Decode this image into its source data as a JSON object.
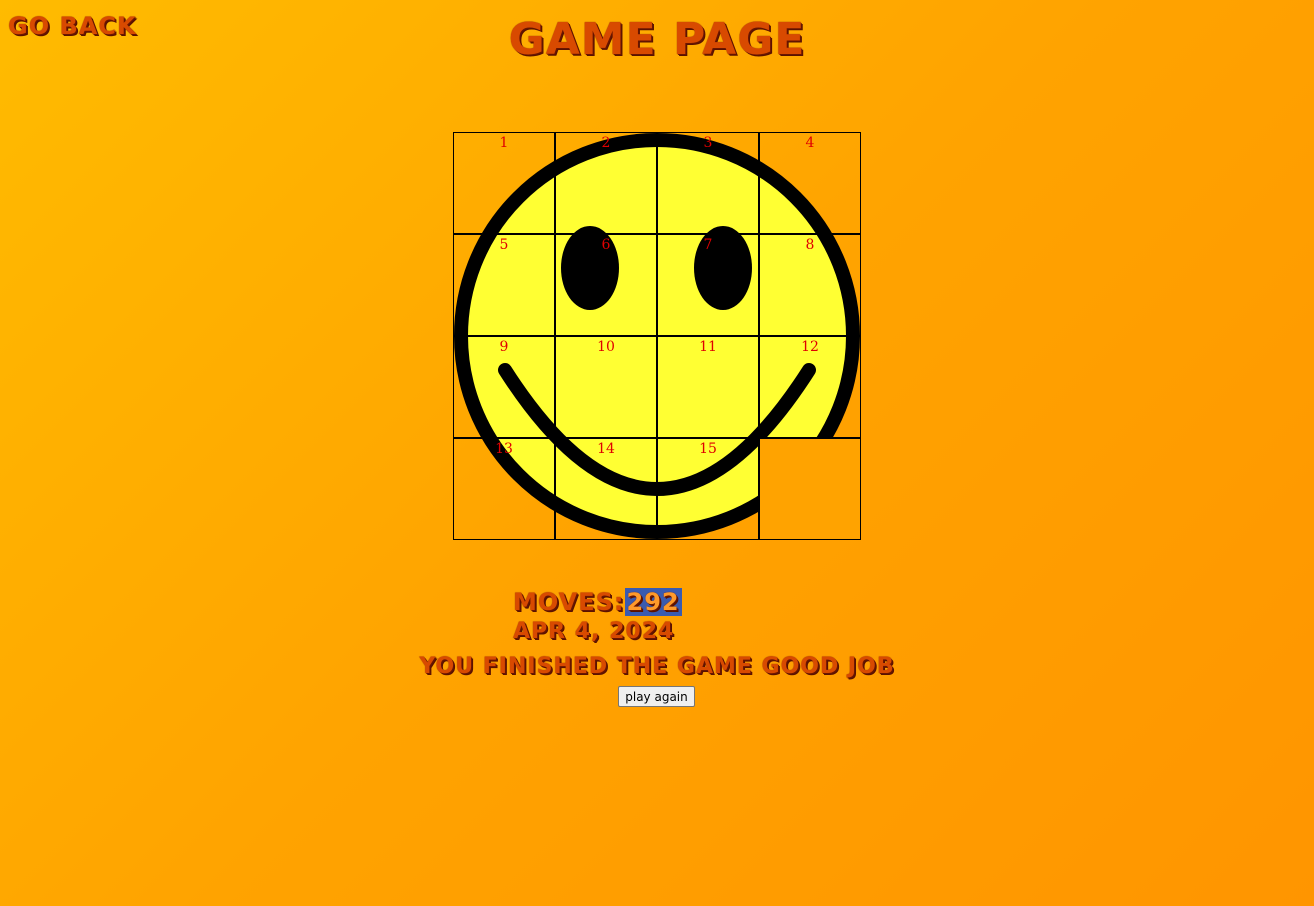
{
  "nav": {
    "go_back_label": "Go Back"
  },
  "page": {
    "title": "Game Page"
  },
  "puzzle": {
    "image_icon": "smiley-face",
    "tiles": [
      {
        "label": "1",
        "row": 0,
        "col": 0
      },
      {
        "label": "2",
        "row": 0,
        "col": 1
      },
      {
        "label": "3",
        "row": 0,
        "col": 2
      },
      {
        "label": "4",
        "row": 0,
        "col": 3
      },
      {
        "label": "5",
        "row": 1,
        "col": 0
      },
      {
        "label": "6",
        "row": 1,
        "col": 1
      },
      {
        "label": "7",
        "row": 1,
        "col": 2
      },
      {
        "label": "8",
        "row": 1,
        "col": 3
      },
      {
        "label": "9",
        "row": 2,
        "col": 0
      },
      {
        "label": "10",
        "row": 2,
        "col": 1
      },
      {
        "label": "11",
        "row": 2,
        "col": 2
      },
      {
        "label": "12",
        "row": 2,
        "col": 3
      },
      {
        "label": "13",
        "row": 3,
        "col": 0
      },
      {
        "label": "14",
        "row": 3,
        "col": 1
      },
      {
        "label": "15",
        "row": 3,
        "col": 2
      },
      {
        "label": "",
        "row": 3,
        "col": 3,
        "empty": true
      }
    ]
  },
  "stats": {
    "moves_label": "Moves:",
    "moves_value": "292",
    "date": "Apr 4, 2024"
  },
  "message": "You finished the game good job",
  "play_again_label": "play again",
  "colors": {
    "background": "#ffa300",
    "face": "#ffff33",
    "tile_number": "#e00000",
    "heading_text": "#d84a00",
    "moves_highlight": "#3a5bb0"
  }
}
